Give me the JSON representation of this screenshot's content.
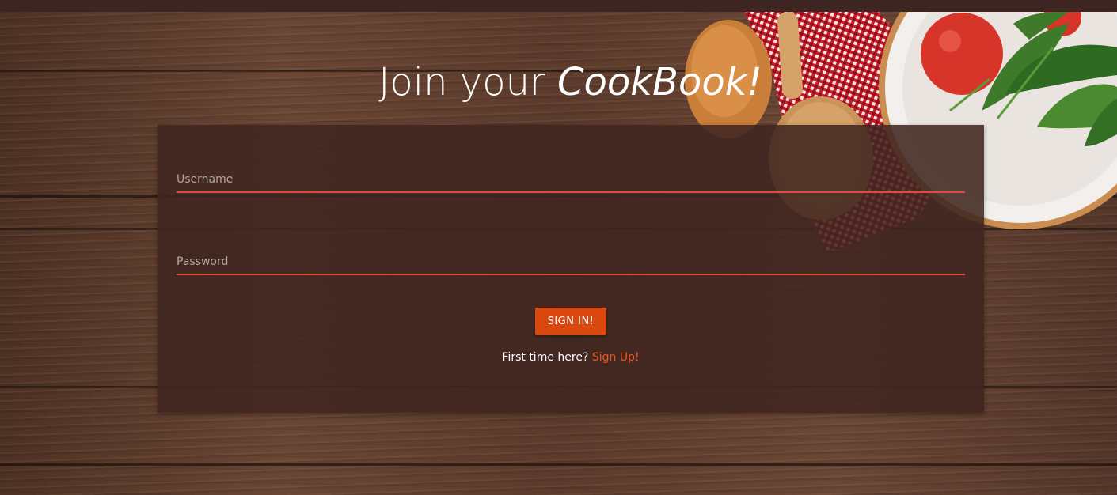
{
  "header": {
    "title_prefix": "Join your ",
    "title_brand": "CookBook!"
  },
  "form": {
    "username": {
      "placeholder": "Username",
      "value": ""
    },
    "password": {
      "placeholder": "Password",
      "value": ""
    },
    "submit_label": "SIGN IN!",
    "signup_prompt": "First time here?",
    "signup_link": "Sign Up!"
  },
  "colors": {
    "accent": "#d9480f",
    "field_underline": "#e04b3f",
    "link": "#e8581c",
    "card_background": "#402520"
  }
}
